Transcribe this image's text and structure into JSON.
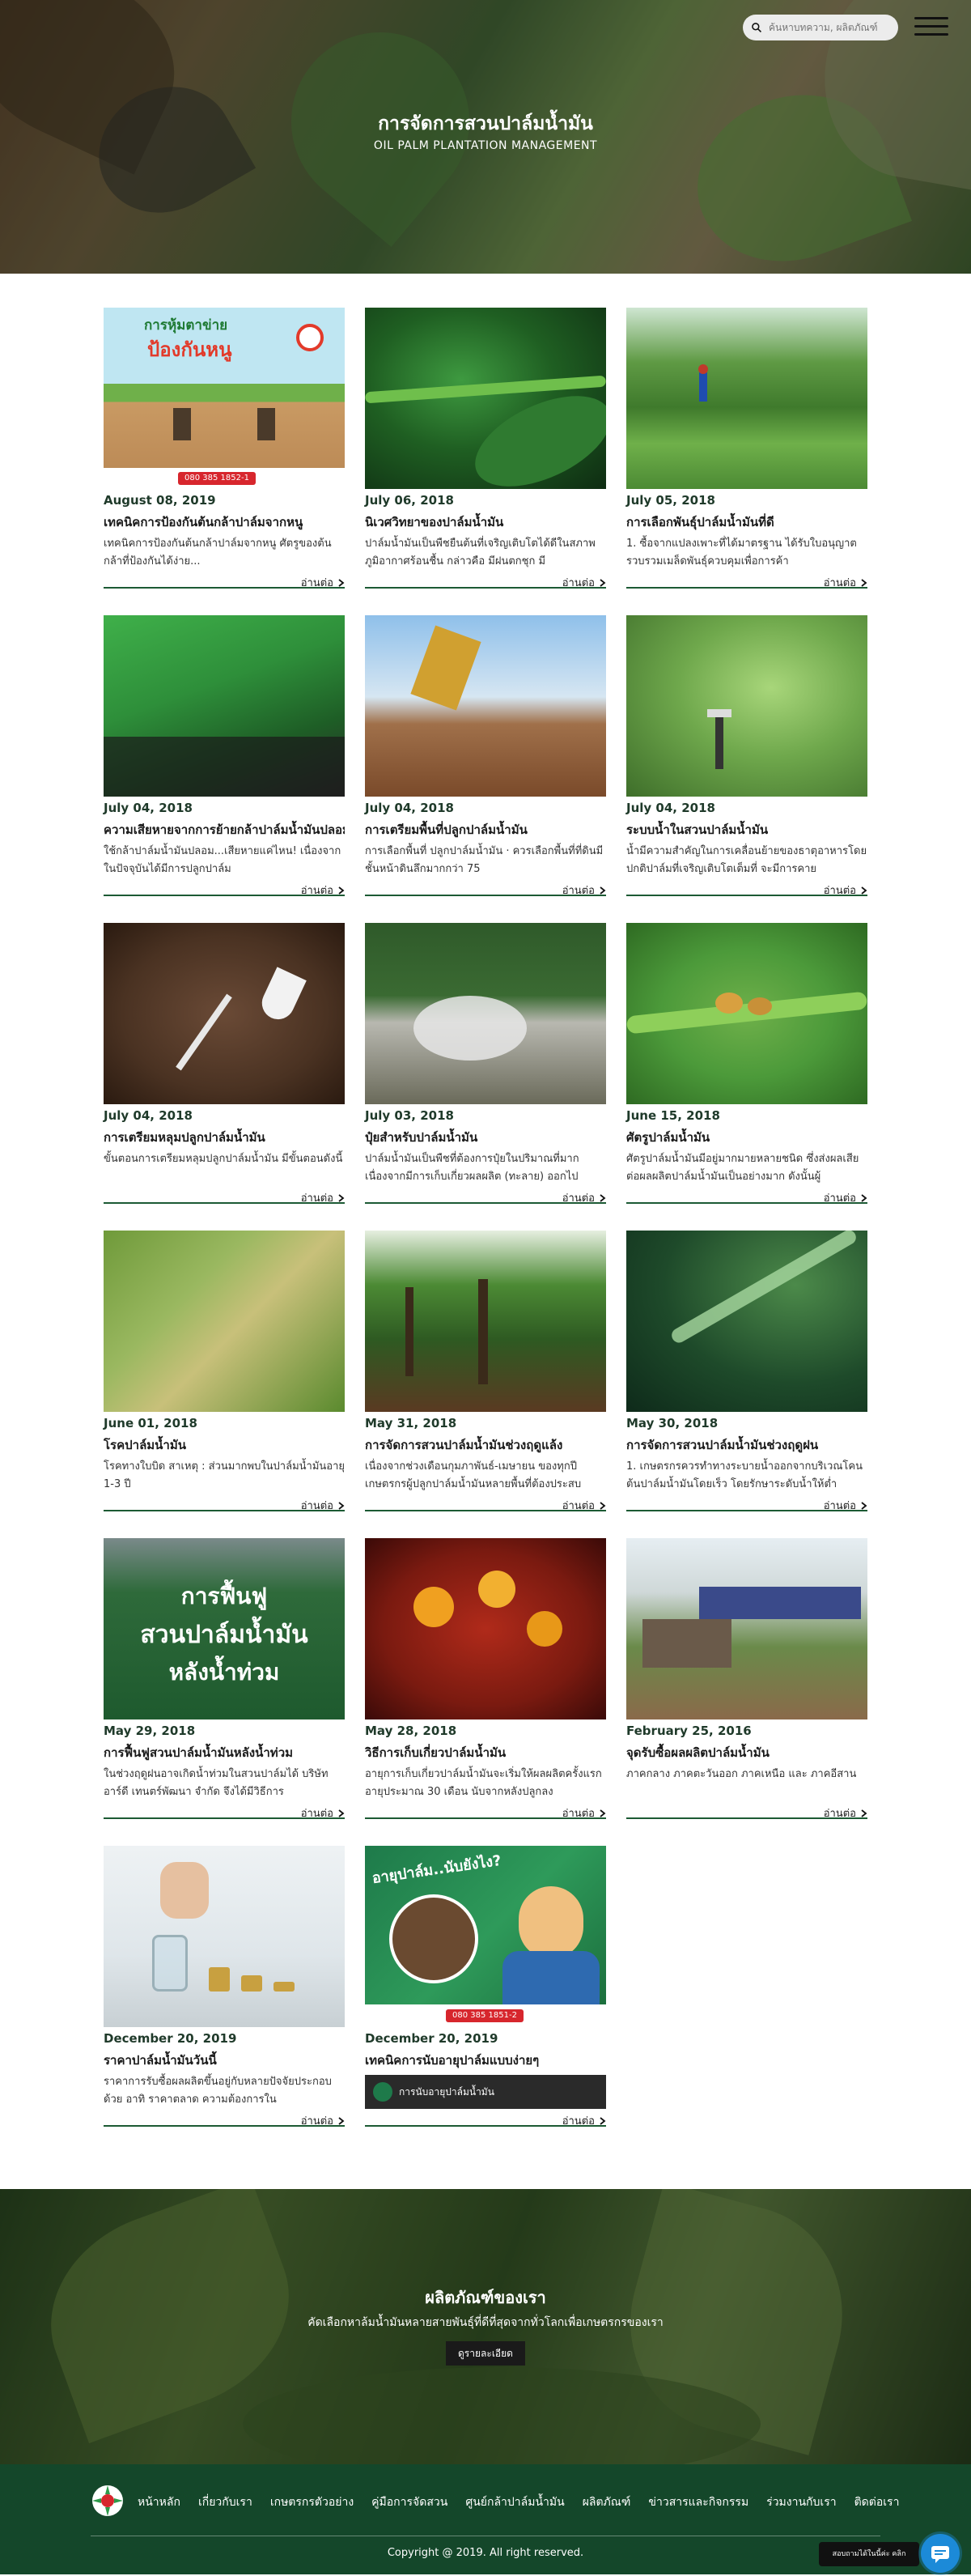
{
  "hero": {
    "title": "การจัดการสวนปาล์มน้ำมัน",
    "subtitle": "OIL PALM PLANTATION MANAGEMENT",
    "search_placeholder": "ค้นหาบทความ, ผลิตภัณฑ์"
  },
  "articles": [
    {
      "date": "August 08, 2019",
      "title": "เทคนิคการป้องกันต้นกล้าปาล์มจากหนู",
      "desc": "เทคนิคการป้องกันต้นกล้าปาล์มจากหนู ศัตรูของต้นกล้าที่ป้องกันได้ง่าย...",
      "img_text_top": "การหุ้มตาข่าย",
      "img_text_bottom": "ป้องกันหนู",
      "img_phone": "080 385 1852-1"
    },
    {
      "date": "July 06, 2018",
      "title": "นิเวศวิทยาของปาล์มน้ำมัน",
      "desc": "ปาล์มน้ำมันเป็นพืชยืนต้นที่เจริญเติบโตได้ดีในสภาพภูมิอากาศร้อนชื้น กล่าวคือ มีฝนตกชุก มี"
    },
    {
      "date": "July 05, 2018",
      "title": "การเลือกพันธุ์ปาล์มน้ำมันที่ดี",
      "desc": "1. ซื้อจากแปลงเพาะที่ได้มาตรฐาน ได้รับใบอนุญาตรวบรวมเมล็ดพันธุ์ควบคุมเพื่อการค้า"
    },
    {
      "date": "July 04, 2018",
      "title": "ความเสียหายจากการย้ายกล้าปาล์มน้ำมันปลอม",
      "desc": "ใช้กล้าปาล์มน้ำมันปลอม...เสียหายแค่ไหน! เนื่องจากในปัจจุบันได้มีการปลูกปาล์ม"
    },
    {
      "date": "July 04, 2018",
      "title": "การเตรียมพื้นที่ปลูกปาล์มน้ำมัน",
      "desc": "การเลือกพื้นที่ ปลูกปาล์มน้ำมัน · ควรเลือกพื้นที่ที่ดินมีชั้นหน้าดินลึกมากกว่า 75"
    },
    {
      "date": "July 04, 2018",
      "title": "ระบบน้ำในสวนปาล์มน้ำมัน",
      "desc": "น้ำมีความสำคัญในการเคลื่อนย้ายของธาตุอาหารโดยปกติปาล์มที่เจริญเติบโตเต็มที่ จะมีการคาย"
    },
    {
      "date": "July 04, 2018",
      "title": "การเตรียมหลุมปลูกปาล์มน้ำมัน",
      "desc": "ขั้นตอนการเตรียมหลุมปลูกปาล์มน้ำมัน มีขั้นตอนดังนี้"
    },
    {
      "date": "July 03, 2018",
      "title": "ปุ๋ยสำหรับปาล์มน้ำมัน",
      "desc": "ปาล์มน้ำมันเป็นพืชที่ต้องการปุ๋ยในปริมาณที่มากเนื่องจากมีการเก็บเกี่ยวผลผลิต (ทะลาย) ออกไป"
    },
    {
      "date": "June 15, 2018",
      "title": "ศัตรูปาล์มน้ำมัน",
      "desc": "ศัตรูปาล์มน้ำมันมีอยู่มากมายหลายชนิด ซึ่งส่งผลเสียต่อผลผลิตปาล์มน้ำมันเป็นอย่างมาก ดังนั้นผู้"
    },
    {
      "date": "June 01, 2018",
      "title": "โรคปาล์มน้ำมัน",
      "desc": "โรคทางใบบิด สาเหตุ : ส่วนมากพบในปาล์มน้ำมันอายุ 1-3 ปี"
    },
    {
      "date": "May 31, 2018",
      "title": "การจัดการสวนปาล์มน้ำมันช่วงฤดูแล้ง",
      "desc": "เนื่องจากช่วงเดือนกุมภาพันธ์-เมษายน ของทุกปีเกษตรกรผู้ปลูกปาล์มน้ำมันหลายพื้นที่ต้องประสบ"
    },
    {
      "date": "May 30, 2018",
      "title": "การจัดการสวนปาล์มน้ำมันช่วงฤดูฝน",
      "desc": "1. เกษตรกรควรทำทางระบายน้ำออกจากบริเวณโคนต้นปาล์มน้ำมันโดยเร็ว โดยรักษาระดับน้ำให้ต่ำ"
    },
    {
      "date": "May 29, 2018",
      "title": "การฟื้นฟูสวนปาล์มน้ำมันหลังน้ำท่วม",
      "desc": "ในช่วงฤดูฝนอาจเกิดน้ำท่วมในสวนปาล์มได้ บริษัท อาร์ดี เทนตร์พัฒนา จำกัด จึงได้มีวิธีการ",
      "img_text_1": "การฟื้นฟู",
      "img_text_2": "สวนปาล์มน้ำมัน",
      "img_text_3": "หลังน้ำท่วม"
    },
    {
      "date": "May 28, 2018",
      "title": "วิธีการเก็บเกี่ยวปาล์มน้ำมัน",
      "desc": "อายุการเก็บเกี่ยวปาล์มน้ำมันจะเริ่มให้ผลผลิตครั้งแรกอายุประมาณ 30 เดือน นับจากหลังปลูกลง"
    },
    {
      "date": "February 25, 2016",
      "title": "จุดรับซื้อผลผลิตปาล์มน้ำมัน",
      "desc": "ภาคกลาง ภาคตะวันออก ภาคเหนือ และ ภาคอีสาน"
    },
    {
      "date": "December 20, 2019",
      "title": "ราคาปาล์มน้ำมันวันนี้",
      "desc": "ราคาการรับซื้อผลผลิตขึ้นอยู่กับหลายปัจจัยประกอบด้วย อาทิ ราคาตลาด ความต้องการใน"
    },
    {
      "date": "December 20, 2019",
      "title": "เทคนิคการนับอายุปาล์มแบบง่ายๆ",
      "desc": "",
      "img_text": "อายุปาล์ม..นับยังไง?",
      "img_phone": "080 385 1851-2",
      "video_caption": "การนับอายุปาล์มน้ำมัน"
    }
  ],
  "read_more_label": "อ่านต่อ",
  "banner": {
    "title": "ผลิตภัณฑ์ของเรา",
    "subtitle": "คัดเลือกหาล้มน้ำมันหลายสายพันธุ์ที่ดีที่สุดจากทั่วโลกเพื่อเกษตรกรของเรา",
    "button_label": "ดูรายละเอียด"
  },
  "footer": {
    "nav": [
      "หน้าหลัก",
      "เกี่ยวกับเรา",
      "เกษตรกรตัวอย่าง",
      "คู่มือการจัดสวน",
      "ศูนย์กล้าปาล์มน้ำมัน",
      "ผลิตภัณฑ์",
      "ข่าวสารและกิจกรรม",
      "ร่วมงานกับเรา",
      "ติดต่อเรา"
    ],
    "copyright": "Copyright @ 2019. All right reserved.",
    "chat_label": "สอบถามได้ในนี้ค่ะ คลิก"
  },
  "colors": {
    "primary_green": "#14472a",
    "accent_line": "#1c5a34",
    "chat_blue": "#1c8ad8"
  }
}
